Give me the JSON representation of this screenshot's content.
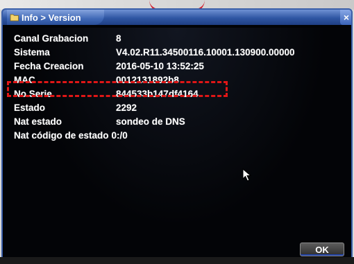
{
  "window": {
    "title": "Info > Version",
    "close_symbol": "×",
    "icon": "info-folder-icon"
  },
  "info_rows": [
    {
      "label": "Canal Grabacion",
      "value": "8"
    },
    {
      "label": "Sistema",
      "value": "V4.02.R11.34500116.10001.130900.00000"
    },
    {
      "label": "Fecha Creacion",
      "value": "2016-05-10 13:52:25"
    },
    {
      "label": "MAC",
      "value": "0012131892b8"
    },
    {
      "label": "No.Serie",
      "value": "844533b147df4164"
    },
    {
      "label": "Estado",
      "value": "2292"
    },
    {
      "label": "Nat estado",
      "value": "sondeo de DNS"
    },
    {
      "label": "Nat código de estado",
      "value": "0:/0"
    }
  ],
  "highlighted_row": "No.Serie",
  "buttons": {
    "ok_label": "OK"
  },
  "colors": {
    "dialog_background": "#030407",
    "title_bar": "#2f56a3",
    "text": "#ffffff",
    "highlight": "#e01616"
  }
}
